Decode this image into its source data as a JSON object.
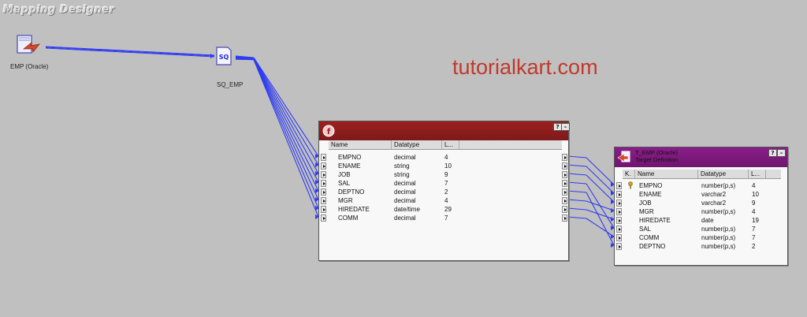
{
  "designer": {
    "title": "Mapping Designer"
  },
  "watermark": "tutorialkart.com",
  "source": {
    "label": "EMP (Oracle)",
    "icon": "source-definition-icon"
  },
  "source_qualifier": {
    "label": "SQ_EMP",
    "icon_text": "SQ",
    "icon": "source-qualifier-icon"
  },
  "expression": {
    "icon": "expression-icon",
    "columns": [
      "Name",
      "Datatype",
      "L..."
    ],
    "rows": [
      {
        "name": "EMPNO",
        "type": "decimal",
        "len": "4"
      },
      {
        "name": "ENAME",
        "type": "string",
        "len": "10"
      },
      {
        "name": "JOB",
        "type": "string",
        "len": "9"
      },
      {
        "name": "SAL",
        "type": "decimal",
        "len": "7"
      },
      {
        "name": "DEPTNO",
        "type": "decimal",
        "len": "2"
      },
      {
        "name": "MGR",
        "type": "decimal",
        "len": "4"
      },
      {
        "name": "HIREDATE",
        "type": "date/time",
        "len": "29"
      },
      {
        "name": "COMM",
        "type": "decimal",
        "len": "7"
      }
    ]
  },
  "target": {
    "title_line1": "T_EMP (Oracle)",
    "title_line2": "Target Definition",
    "icon": "target-definition-icon",
    "columns": [
      "K.",
      "Name",
      "Datatype",
      "L..."
    ],
    "rows": [
      {
        "key": "key-icon",
        "name": "EMPNO",
        "type": "number(p,s)",
        "len": "4"
      },
      {
        "key": "",
        "name": "ENAME",
        "type": "varchar2",
        "len": "10"
      },
      {
        "key": "",
        "name": "JOB",
        "type": "varchar2",
        "len": "9"
      },
      {
        "key": "",
        "name": "MGR",
        "type": "number(p,s)",
        "len": "4"
      },
      {
        "key": "",
        "name": "HIREDATE",
        "type": "date",
        "len": "19"
      },
      {
        "key": "",
        "name": "SAL",
        "type": "number(p,s)",
        "len": "7"
      },
      {
        "key": "",
        "name": "COMM",
        "type": "number(p,s)",
        "len": "7"
      },
      {
        "key": "",
        "name": "DEPTNO",
        "type": "number(p,s)",
        "len": "2"
      }
    ]
  },
  "window_buttons": {
    "help": "?",
    "minimize": "–"
  },
  "colors": {
    "link": "#2f3cf0",
    "expression_bar": "#8e1c1c",
    "target_bar": "#7f197f",
    "watermark": "#c0392b"
  }
}
